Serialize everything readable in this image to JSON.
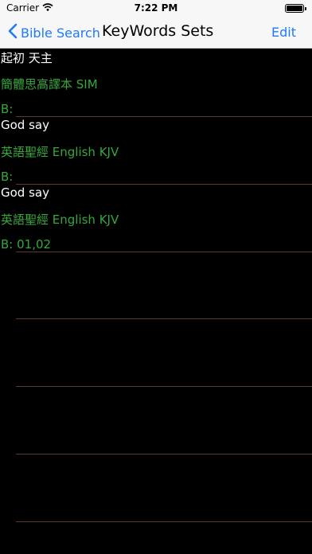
{
  "status_bar": {
    "carrier": "Carrier",
    "time": "7:22 PM"
  },
  "nav": {
    "back_label": "Bible Search",
    "title": "KeyWords Sets",
    "edit_label": "Edit"
  },
  "top_line": "起初 天主",
  "rows": [
    {
      "version": "簡體思高譯本 SIM",
      "books": "B:",
      "keywords": "God say"
    },
    {
      "version": "英語聖經 English KJV",
      "books": "B:",
      "keywords": "God say"
    },
    {
      "version": "英語聖經 English KJV",
      "books": "B: 01,02"
    }
  ],
  "colors": {
    "accent": "#1e7bf5",
    "green_text": "#35a83a",
    "background": "#000000"
  },
  "icons": [
    "wifi-icon",
    "battery-icon",
    "chevron-left-icon"
  ]
}
